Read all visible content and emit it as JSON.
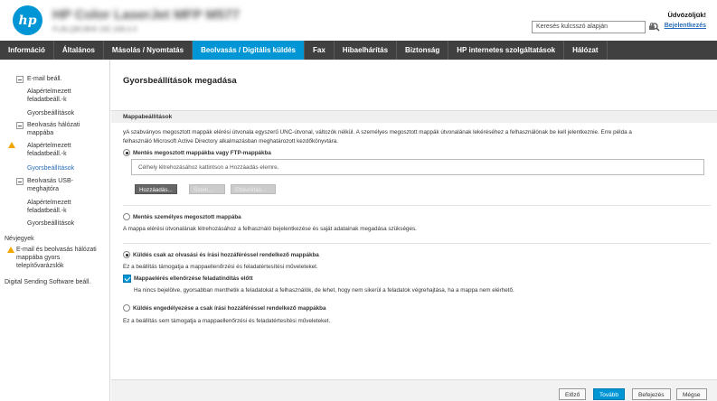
{
  "header": {
    "logo": "hp",
    "title": "HP Color LaserJet MFP M577",
    "subtitle": "FL8LQ8C8K8  192.168.0.0",
    "search_placeholder": "Keresés kulcsszó alapján",
    "welcome": "Üdvözöljük!",
    "login": "Bejelentkezés"
  },
  "nav": {
    "items": [
      "Információ",
      "Általános",
      "Másolás / Nyomtatás",
      "Beolvasás / Digitális küldés",
      "Fax",
      "Hibaelhárítás",
      "Biztonság",
      "HP internetes szolgáltatások",
      "Hálózat"
    ],
    "active_index": 3
  },
  "sidebar": {
    "email": "E-mail beáll.",
    "email_defaults_1": "Alapértelmezett",
    "email_defaults_2": "feladatbeáll.-k",
    "email_quick": "Gyorsbeállítások",
    "network_1": "Beolvasás hálózati",
    "network_2": "mappába",
    "network_defaults_1": "Alapértelmezett",
    "network_defaults_2": "feladatbeáll.-k",
    "network_quick": "Gyorsbeállítások",
    "usb_1": "Beolvasás USB-",
    "usb_2": "meghajtóra",
    "usb_defaults_1": "Alapértelmezett",
    "usb_defaults_2": "feladatbeáll.-k",
    "usb_quick": "Gyorsbeállítások",
    "contacts": "Névjegyek",
    "setup_1": "E-mail és beolvasás hálózati",
    "setup_2": "mappába gyors",
    "setup_3": "telepítővarázslók",
    "digital": "Digital Sending Software beáll."
  },
  "main": {
    "title": "Gyorsbeállítások megadása",
    "section": "Mappabeállítások",
    "intro_1": "yA szabványos megosztott mappák elérési útvonala egyszerű UNC-útvonal, változók nélkül. A személyes megosztott mappák útvonalának lekéréséhez a felhasználónak be kell jelentkeznie. Erre példa a",
    "intro_2": "felhasználó Microsoft Active Directory alkalmazásban meghatározott kezdőkönyvtára.",
    "opt1_label": "Mentés megosztott mappákba vagy FTP-mappákba",
    "path_placeholder": "Célhely létrehozásához kattintson a Hozzáadás elemre.",
    "btn_add": "Hozzáadás...",
    "btn_edit": "Szerk...",
    "btn_remove": "Eltávolítás...",
    "opt2_label": "Mentés személyes megosztott mappába",
    "opt2_desc": "A mappa elérési útvonalának létrehozásához a felhasználó bejelentkezése és saját adatainak megadása szükséges.",
    "opt3_label": "Küldés csak az olvasási és írási hozzáféréssel rendelkező mappákba",
    "opt3_desc": "Ez a beállítás támogatja a mappaellenőrzési és feladatértesítési műveleteket.",
    "check_label": "Mappaelérés ellenőrzése feladatindítás előtt",
    "check_desc": "Ha nincs bejelölve, gyorsabban menthetik a feladatokat a felhasználók, de lehet, hogy nem sikerül a feladatok végrehajtása, ha a mappa nem elérhető.",
    "opt4_label": "Küldés engedélyezése a csak írási hozzáféréssel rendelkező mappákba",
    "opt4_desc": "Ez a beállítás sem támogatja a mappaellenőrzési és feladatértesítési műveleteket."
  },
  "footer": {
    "prev": "Előző",
    "next": "Tovább",
    "finish": "Befejezés",
    "cancel": "Mégse"
  },
  "colors": {
    "accent": "#0096d6",
    "nav_bg": "#404040",
    "warning": "#f0a800"
  }
}
